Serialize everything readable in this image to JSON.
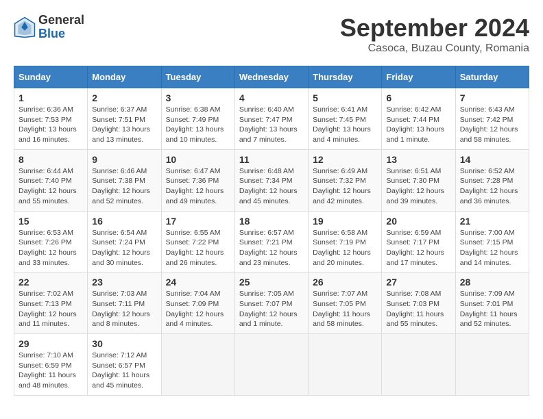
{
  "header": {
    "logo_general": "General",
    "logo_blue": "Blue",
    "month_title": "September 2024",
    "subtitle": "Casoca, Buzau County, Romania"
  },
  "calendar": {
    "days_of_week": [
      "Sunday",
      "Monday",
      "Tuesday",
      "Wednesday",
      "Thursday",
      "Friday",
      "Saturday"
    ],
    "weeks": [
      [
        {
          "day": "",
          "detail": ""
        },
        {
          "day": "",
          "detail": ""
        },
        {
          "day": "",
          "detail": ""
        },
        {
          "day": "",
          "detail": ""
        },
        {
          "day": "",
          "detail": ""
        },
        {
          "day": "",
          "detail": ""
        },
        {
          "day": "1",
          "detail": "Sunrise: 6:36 AM\nSunset: 7:53 PM\nDaylight: 13 hours\nand 16 minutes."
        }
      ],
      [
        {
          "day": "2",
          "detail": "Sunrise: 6:37 AM\nSunset: 7:51 PM\nDaylight: 13 hours\nand 13 minutes."
        },
        {
          "day": "3",
          "detail": "Sunrise: 6:38 AM\nSunset: 7:49 PM\nDaylight: 13 hours\nand 10 minutes."
        },
        {
          "day": "4",
          "detail": "Sunrise: 6:40 AM\nSunset: 7:47 PM\nDaylight: 13 hours\nand 7 minutes."
        },
        {
          "day": "5",
          "detail": "Sunrise: 6:41 AM\nSunset: 7:45 PM\nDaylight: 13 hours\nand 4 minutes."
        },
        {
          "day": "6",
          "detail": "Sunrise: 6:42 AM\nSunset: 7:44 PM\nDaylight: 13 hours\nand 1 minute."
        },
        {
          "day": "7",
          "detail": "Sunrise: 6:43 AM\nSunset: 7:42 PM\nDaylight: 12 hours\nand 58 minutes."
        }
      ],
      [
        {
          "day": "8",
          "detail": "Sunrise: 6:44 AM\nSunset: 7:40 PM\nDaylight: 12 hours\nand 55 minutes."
        },
        {
          "day": "9",
          "detail": "Sunrise: 6:46 AM\nSunset: 7:38 PM\nDaylight: 12 hours\nand 52 minutes."
        },
        {
          "day": "10",
          "detail": "Sunrise: 6:47 AM\nSunset: 7:36 PM\nDaylight: 12 hours\nand 49 minutes."
        },
        {
          "day": "11",
          "detail": "Sunrise: 6:48 AM\nSunset: 7:34 PM\nDaylight: 12 hours\nand 45 minutes."
        },
        {
          "day": "12",
          "detail": "Sunrise: 6:49 AM\nSunset: 7:32 PM\nDaylight: 12 hours\nand 42 minutes."
        },
        {
          "day": "13",
          "detail": "Sunrise: 6:51 AM\nSunset: 7:30 PM\nDaylight: 12 hours\nand 39 minutes."
        },
        {
          "day": "14",
          "detail": "Sunrise: 6:52 AM\nSunset: 7:28 PM\nDaylight: 12 hours\nand 36 minutes."
        }
      ],
      [
        {
          "day": "15",
          "detail": "Sunrise: 6:53 AM\nSunset: 7:26 PM\nDaylight: 12 hours\nand 33 minutes."
        },
        {
          "day": "16",
          "detail": "Sunrise: 6:54 AM\nSunset: 7:24 PM\nDaylight: 12 hours\nand 30 minutes."
        },
        {
          "day": "17",
          "detail": "Sunrise: 6:55 AM\nSunset: 7:22 PM\nDaylight: 12 hours\nand 26 minutes."
        },
        {
          "day": "18",
          "detail": "Sunrise: 6:57 AM\nSunset: 7:21 PM\nDaylight: 12 hours\nand 23 minutes."
        },
        {
          "day": "19",
          "detail": "Sunrise: 6:58 AM\nSunset: 7:19 PM\nDaylight: 12 hours\nand 20 minutes."
        },
        {
          "day": "20",
          "detail": "Sunrise: 6:59 AM\nSunset: 7:17 PM\nDaylight: 12 hours\nand 17 minutes."
        },
        {
          "day": "21",
          "detail": "Sunrise: 7:00 AM\nSunset: 7:15 PM\nDaylight: 12 hours\nand 14 minutes."
        }
      ],
      [
        {
          "day": "22",
          "detail": "Sunrise: 7:02 AM\nSunset: 7:13 PM\nDaylight: 12 hours\nand 11 minutes."
        },
        {
          "day": "23",
          "detail": "Sunrise: 7:03 AM\nSunset: 7:11 PM\nDaylight: 12 hours\nand 8 minutes."
        },
        {
          "day": "24",
          "detail": "Sunrise: 7:04 AM\nSunset: 7:09 PM\nDaylight: 12 hours\nand 4 minutes."
        },
        {
          "day": "25",
          "detail": "Sunrise: 7:05 AM\nSunset: 7:07 PM\nDaylight: 12 hours\nand 1 minute."
        },
        {
          "day": "26",
          "detail": "Sunrise: 7:07 AM\nSunset: 7:05 PM\nDaylight: 11 hours\nand 58 minutes."
        },
        {
          "day": "27",
          "detail": "Sunrise: 7:08 AM\nSunset: 7:03 PM\nDaylight: 11 hours\nand 55 minutes."
        },
        {
          "day": "28",
          "detail": "Sunrise: 7:09 AM\nSunset: 7:01 PM\nDaylight: 11 hours\nand 52 minutes."
        }
      ],
      [
        {
          "day": "29",
          "detail": "Sunrise: 7:10 AM\nSunset: 6:59 PM\nDaylight: 11 hours\nand 48 minutes."
        },
        {
          "day": "30",
          "detail": "Sunrise: 7:12 AM\nSunset: 6:57 PM\nDaylight: 11 hours\nand 45 minutes."
        },
        {
          "day": "",
          "detail": ""
        },
        {
          "day": "",
          "detail": ""
        },
        {
          "day": "",
          "detail": ""
        },
        {
          "day": "",
          "detail": ""
        },
        {
          "day": "",
          "detail": ""
        }
      ]
    ]
  }
}
